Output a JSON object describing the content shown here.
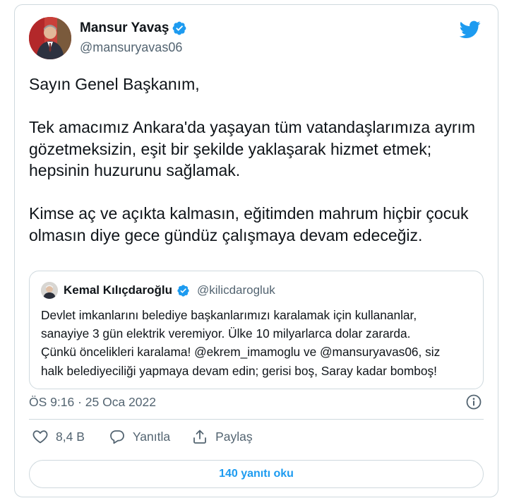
{
  "tweet": {
    "author": {
      "name": "Mansur Yavaş",
      "handle": "@mansuryavas06",
      "verified": true
    },
    "text": "Sayın Genel Başkanım,\n\nTek amacımız Ankara'da yaşayan tüm vatandaşlarımıza ayrım gözetmeksizin, eşit bir şekilde yaklaşarak hizmet etmek; hepsinin huzurunu sağlamak.\n\nKimse aç ve açıkta kalmasın, eğitimden mahrum hiçbir çocuk olmasın diye gece gündüz çalışmaya devam edeceğiz.",
    "timestamp": "ÖS 9:16 · 25 Oca 2022"
  },
  "quoted_tweet": {
    "author": {
      "name": "Kemal Kılıçdaroğlu",
      "handle": "@kilicdarogluk",
      "verified": true
    },
    "text": "Devlet imkanlarını belediye başkanlarımızı karalamak için kullananlar,\nsanayiye 3 gün elektrik veremiyor. Ülke 10 milyarlarca dolar zararda.\nÇünkü öncelikleri karalama! @ekrem_imamoglu ve @mansuryavas06, siz\nhalk belediyeciliği yapmaya devam edin; gerisi boş, Saray kadar bomboş!"
  },
  "actions": {
    "likes": "8,4 B",
    "reply": "Yanıtla",
    "share": "Paylaş"
  },
  "replies_button": "140 yanıtı oku",
  "colors": {
    "accent": "#1d9bf0",
    "text": "#0f1419",
    "muted": "#536471",
    "border": "#cfd9de"
  },
  "icons": [
    "twitter-bird-icon",
    "verified-badge-icon",
    "info-icon",
    "heart-icon",
    "reply-icon",
    "share-icon"
  ]
}
